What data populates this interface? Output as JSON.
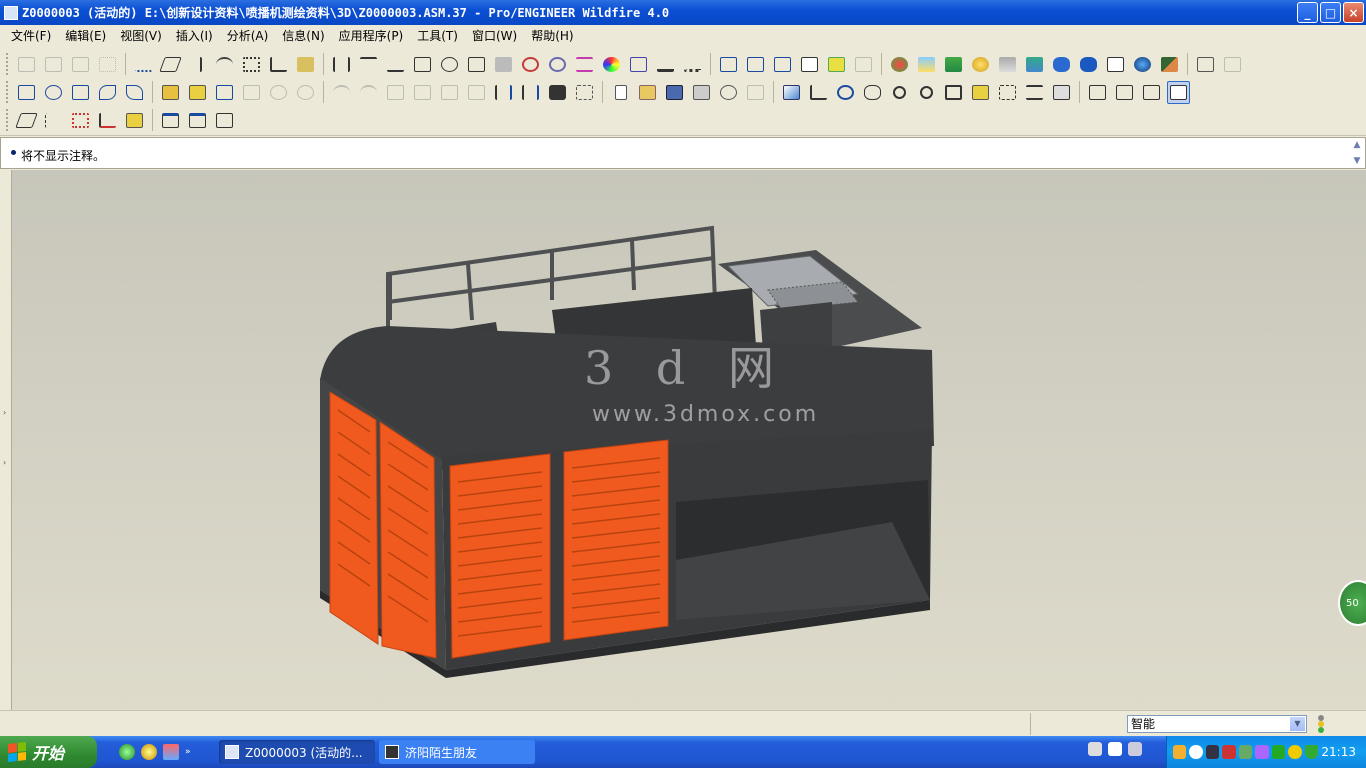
{
  "window": {
    "title": "Z0000003 (活动的) E:\\创新设计资料\\喷播机测绘资料\\3D\\Z0000003.ASM.37 - Pro/ENGINEER Wildfire 4.0",
    "controls": {
      "minimize": "_",
      "maximize": "□",
      "close": "×"
    }
  },
  "menu": [
    "文件(F)",
    "编辑(E)",
    "视图(V)",
    "插入(I)",
    "分析(A)",
    "信息(N)",
    "应用程序(P)",
    "工具(T)",
    "窗口(W)",
    "帮助(H)"
  ],
  "message": {
    "text": "将不显示注释。"
  },
  "viewport": {
    "watermark_main": "3 d 网",
    "watermark_url": "www.3dmox.com",
    "side_badge": "50"
  },
  "status": {
    "filter_value": "智能"
  },
  "taskbar": {
    "start_label": "开始",
    "tasks": [
      {
        "label": "Z0000003 (活动的...",
        "active": true
      },
      {
        "label": "济阳陌生朋友",
        "active": false
      }
    ],
    "clock": "21:13"
  },
  "colors": {
    "model_body": "#3a3b3c",
    "model_door": "#f05a1e",
    "title_bar": "#0b4fd4"
  }
}
